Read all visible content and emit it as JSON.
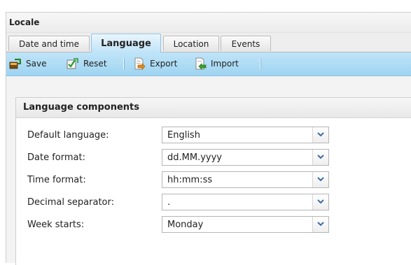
{
  "window": {
    "title": "Locale"
  },
  "tabs": [
    {
      "label": "Date and time",
      "active": false
    },
    {
      "label": "Language",
      "active": true
    },
    {
      "label": "Location",
      "active": false
    },
    {
      "label": "Events",
      "active": false
    }
  ],
  "toolbar": {
    "save_label": "Save",
    "reset_label": "Reset",
    "export_label": "Export",
    "import_label": "Import",
    "save_icon": "save-icon",
    "reset_icon": "reset-icon",
    "export_icon": "export-icon",
    "import_icon": "import-icon"
  },
  "panel": {
    "title": "Language components",
    "fields": [
      {
        "label": "Default language:",
        "value": "English"
      },
      {
        "label": "Date format:",
        "value": "dd.MM.yyyy"
      },
      {
        "label": "Time format:",
        "value": "hh:mm:ss"
      },
      {
        "label": "Decimal separator:",
        "value": "."
      },
      {
        "label": "Week starts:",
        "value": "Monday"
      }
    ]
  },
  "colors": {
    "accent": "#a9daf4",
    "active_tab": "#bfe3f8",
    "arrow": "#3a6ea5"
  }
}
